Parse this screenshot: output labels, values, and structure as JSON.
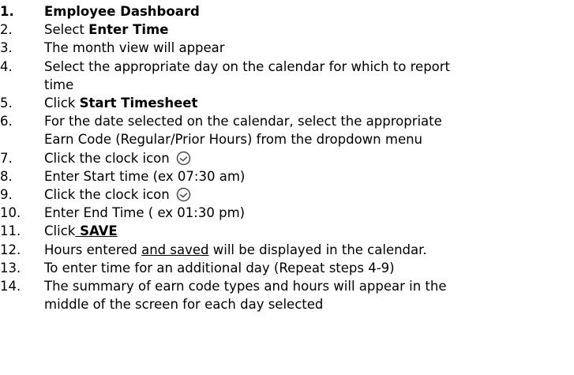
{
  "steps": [
    {
      "num": "1.",
      "text": "Employee Dashboard"
    },
    {
      "num": "2.",
      "pre": "Select ",
      "bold": "Enter Time"
    },
    {
      "num": "3.",
      "text": "The month view will appear"
    },
    {
      "num": "4.",
      "line1": "Select the appropriate day on the calendar for which to report",
      "line2": "time"
    },
    {
      "num": "5.",
      "pre": "Click ",
      "bold": "Start Timesheet"
    },
    {
      "num": "6.",
      "line1": "For the date selected on the calendar, select the appropriate",
      "line2": "Earn Code (Regular/Prior Hours) from the dropdown menu"
    },
    {
      "num": "7.",
      "text": "Click the clock icon",
      "icon": "clock-icon"
    },
    {
      "num": "8.",
      "text": "Enter Start time (ex 07:30 am)"
    },
    {
      "num": "9.",
      "text": "Click the clock icon",
      "icon": "clock-icon"
    },
    {
      "num": "10.",
      "text": "Enter End Time ( ex 01:30 pm)"
    },
    {
      "num": "11.",
      "pre": "Click",
      "bold_underlined": " SAVE"
    },
    {
      "num": "12.",
      "pre": "Hours entered ",
      "underlined": "and saved",
      "post": " will be displayed in the calendar."
    },
    {
      "num": "13.",
      "text": "To enter time for an additional day (Repeat steps 4-9)"
    },
    {
      "num": "14.",
      "line1": "The summary of earn code types and hours will appear in the",
      "line2": "middle of the screen for each day selected"
    }
  ],
  "colors": {
    "text": "#000000",
    "icon_stroke": "#4a4a4a",
    "background": "#ffffff"
  }
}
